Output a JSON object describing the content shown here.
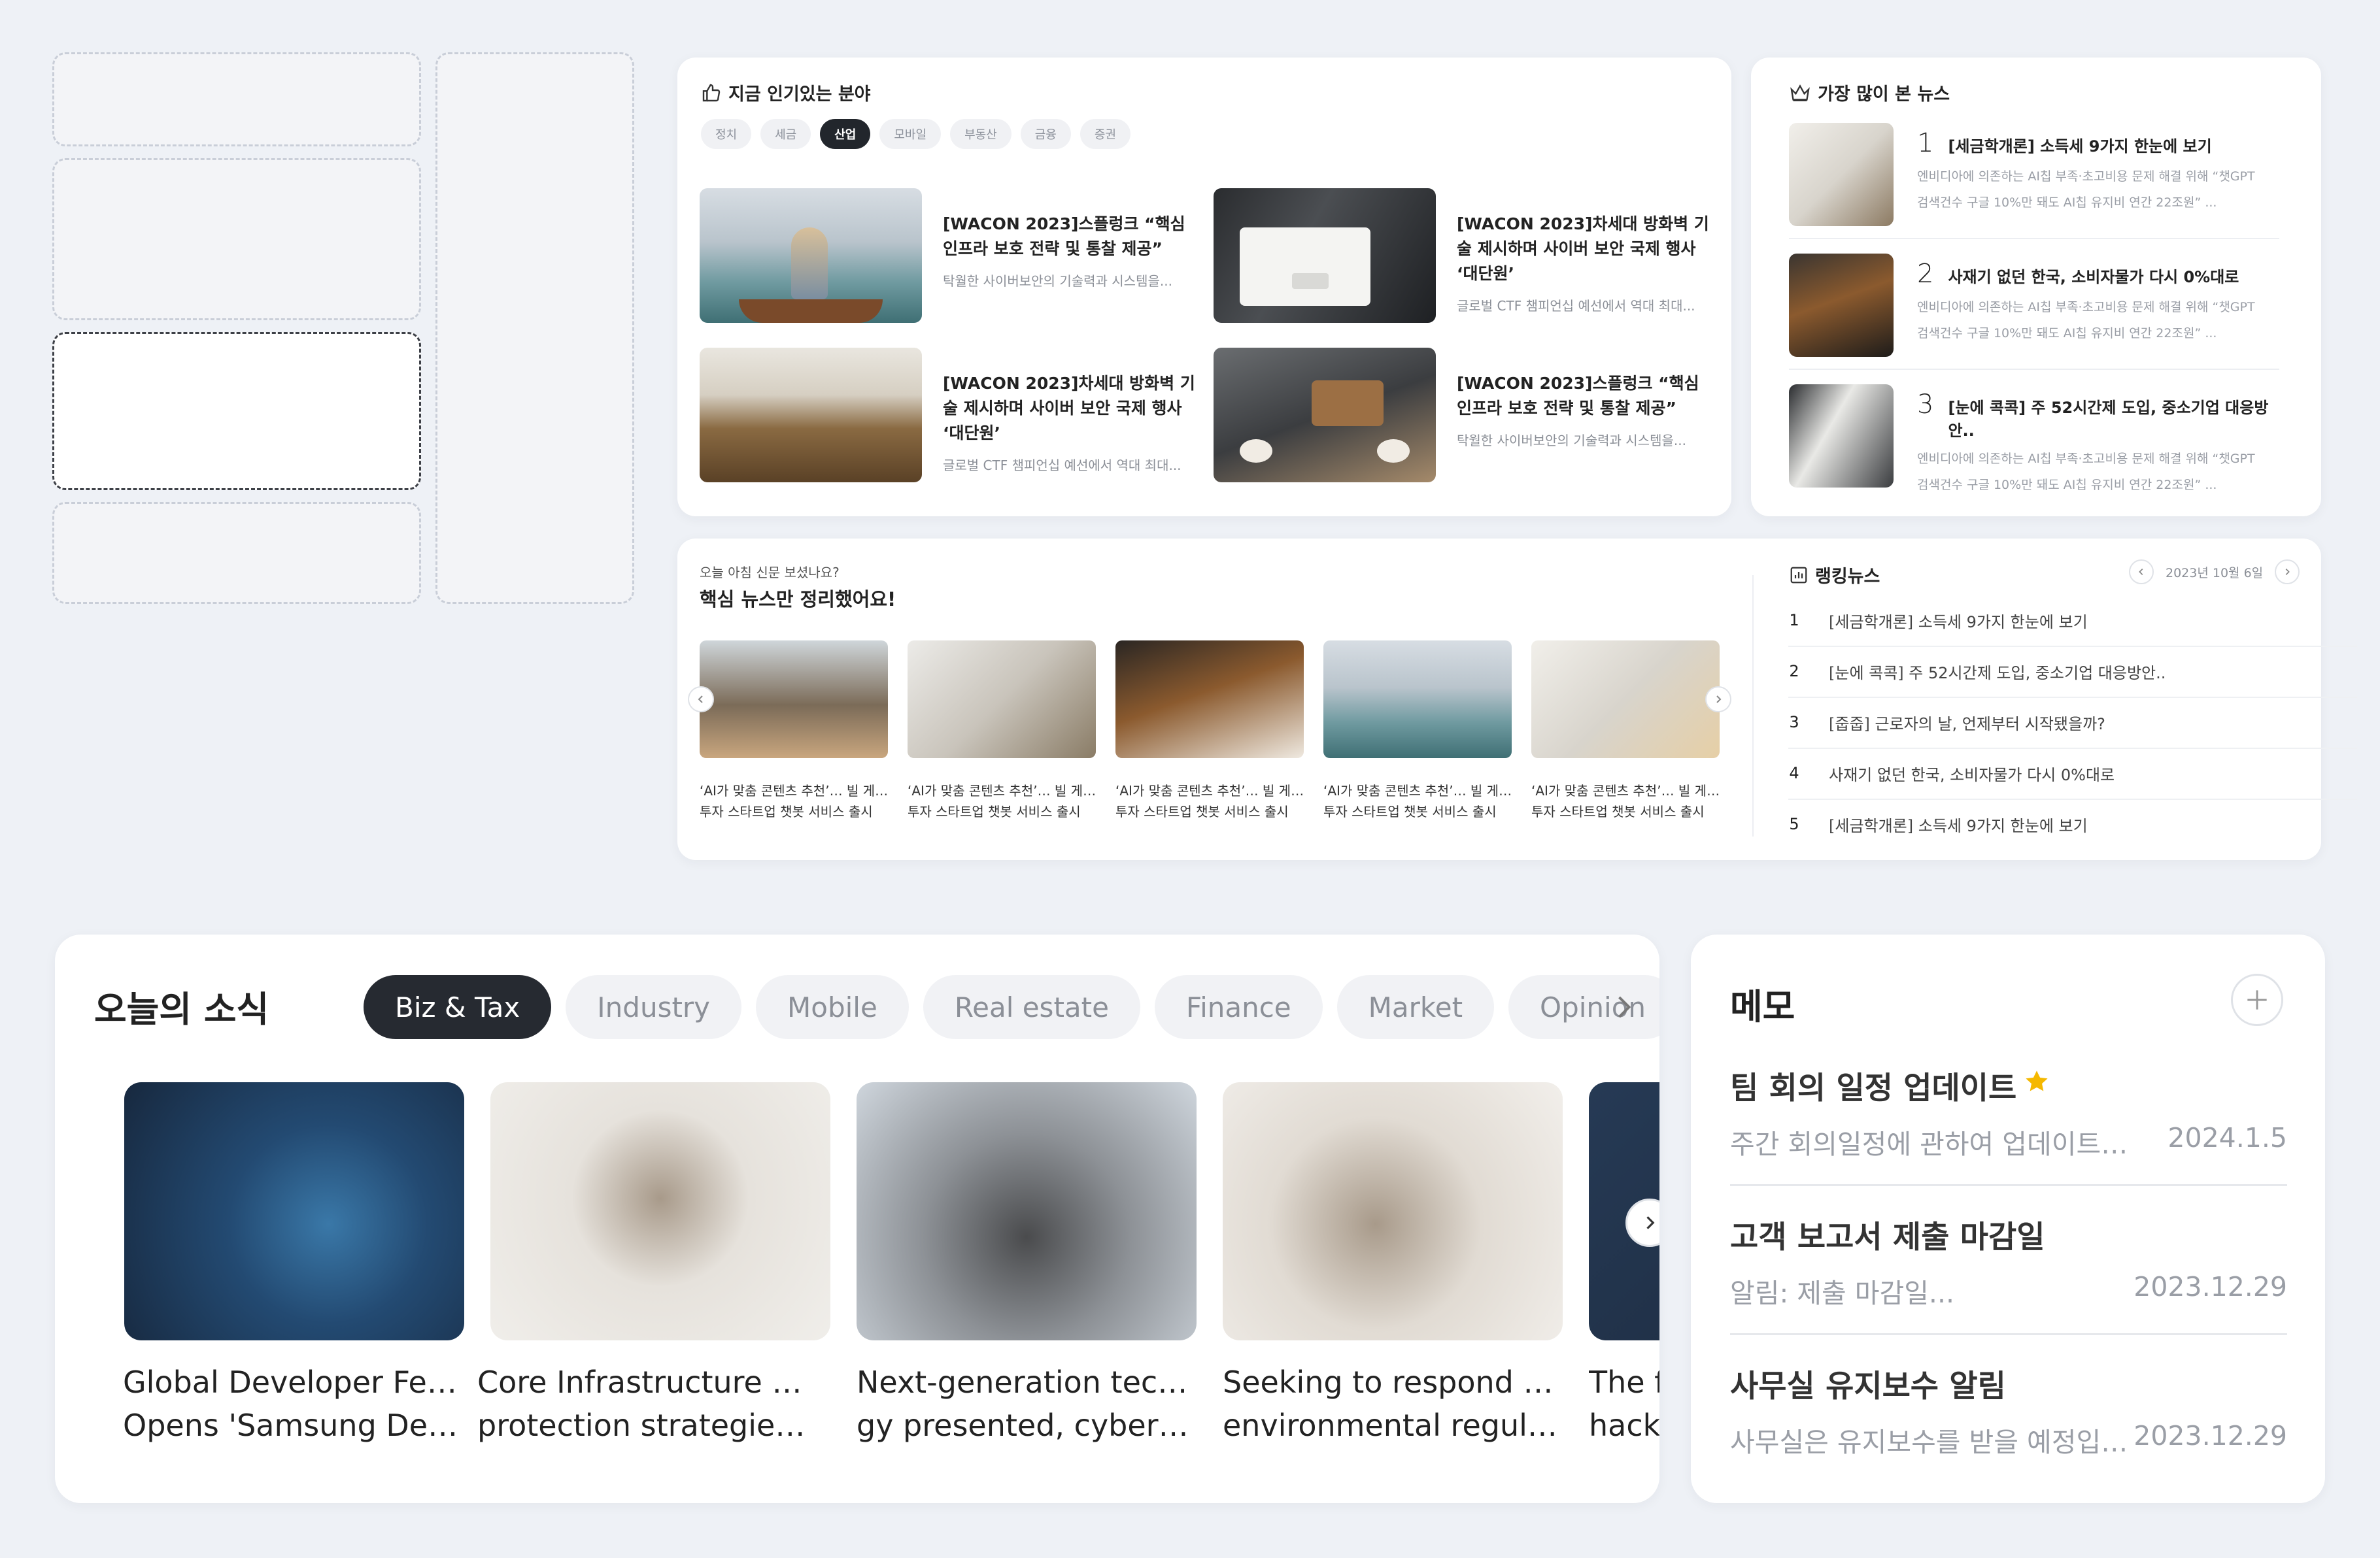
{
  "popular_fields": {
    "title": "지금 인기있는 분야",
    "chips": [
      "정치",
      "세금",
      "산업",
      "모바일",
      "부동산",
      "금융",
      "증권"
    ],
    "active_chip": "산업",
    "items": [
      {
        "title": "[WACON 2023]스플렁크 “핵심 인프라 보호 전략 및 통찰 제공”",
        "desc": "탁월한 사이버보안의 기술력과 시스템을..."
      },
      {
        "title": "[WACON 2023]차세대 방화벽 기술 제시하며 사이버 보안 국제 행사 ‘대단원’",
        "desc": "글로벌 CTF 챔피언십 예선에서 역대 최대..."
      },
      {
        "title": "[WACON 2023]차세대 방화벽 기술 제시하며 사이버 보안 국제 행사 ‘대단원’",
        "desc": "글로벌 CTF 챔피언십 예선에서 역대 최대..."
      },
      {
        "title": "[WACON 2023]스플렁크 “핵심 인프라 보호 전략 및 통찰 제공”",
        "desc": "탁월한 사이버보안의 기술력과 시스템을..."
      }
    ]
  },
  "most_read": {
    "title": "가장 많이 본 뉴스",
    "items": [
      {
        "rank": "1",
        "title": "[세금학개론] 소득세 9가지 한눈에 보기",
        "desc1": "엔비디아에 의존하는 AI칩 부족·초고비용 문제 해결 위해 “챗GPT",
        "desc2": "검색건수 구글 10%만 돼도 AI칩 유지비 연간 22조원” ..."
      },
      {
        "rank": "2",
        "title": "사재기 없던 한국, 소비자물가 다시 0%대로",
        "desc1": "엔비디아에 의존하는 AI칩 부족·초고비용 문제 해결 위해 “챗GPT",
        "desc2": "검색건수 구글 10%만 돼도 AI칩 유지비 연간 22조원” ..."
      },
      {
        "rank": "3",
        "title": "[눈에 콕콕] 주 52시간제 도입, 중소기업 대응방안..",
        "desc1": "엔비디아에 의존하는 AI칩 부족·초고비용 문제 해결 위해 “챗GPT",
        "desc2": "검색건수 구글 10%만 돼도 AI칩 유지비 연간 22조원” ..."
      }
    ]
  },
  "morning": {
    "eyebrow": "오늘 아침 신문 보셨나요?",
    "title": "핵심 뉴스만 정리했어요!",
    "items": [
      {
        "line1": "‘AI가 맞춤 콘텐츠 추천’… 빌 게이츠",
        "line2": "투자 스타트업 챗봇 서비스 출시"
      },
      {
        "line1": "‘AI가 맞춤 콘텐츠 추천’… 빌 게이츠",
        "line2": "투자 스타트업 챗봇 서비스 출시"
      },
      {
        "line1": "‘AI가 맞춤 콘텐츠 추천’… 빌 게이츠",
        "line2": "투자 스타트업 챗봇 서비스 출시"
      },
      {
        "line1": "‘AI가 맞춤 콘텐츠 추천’… 빌 게이츠",
        "line2": "투자 스타트업 챗봇 서비스 출시"
      },
      {
        "line1": "‘AI가 맞춤 콘텐츠 추천’… 빌 게이츠",
        "line2": "투자 스타트업 챗봇 서비스 출시"
      }
    ]
  },
  "ranking": {
    "title": "랭킹뉴스",
    "date": "2023년 10월 6일",
    "items": [
      {
        "rank": "1",
        "title": "[세금학개론] 소득세 9가지 한눈에 보기"
      },
      {
        "rank": "2",
        "title": "[눈에 콕콕] 주 52시간제 도입, 중소기업 대응방안.."
      },
      {
        "rank": "3",
        "title": "[줍줍] 근로자의 날, 언제부터 시작됐을까?"
      },
      {
        "rank": "4",
        "title": "사재기 없던 한국, 소비자물가 다시 0%대로"
      },
      {
        "rank": "5",
        "title": "[세금학개론] 소득세 9가지 한눈에 보기"
      }
    ]
  },
  "today": {
    "title": "오늘의 소식",
    "chips": [
      "Biz & Tax",
      "Industry",
      "Mobile",
      "Real estate",
      "Finance",
      "Market",
      "Opinion"
    ],
    "active_chip": "Biz & Tax",
    "items": [
      {
        "line1": "Global Developer Festival",
        "line2": "Opens 'Samsung Devel..."
      },
      {
        "line1": "Core Infrastructure provide",
        "line2": "protection strategies and..."
      },
      {
        "line1": "Next-generation technolo",
        "line2": "gy presented, cybersecur..."
      },
      {
        "line1": "Seeking to respond to EU",
        "line2": "environmental regulation"
      },
      {
        "line1": "The f",
        "line2": "hacki"
      }
    ]
  },
  "memo": {
    "title": "메모",
    "items": [
      {
        "title": "팀 회의 일정 업데이트",
        "starred": true,
        "preview": "주간 회의일정에 관하여 업데이트가 있...",
        "date": "2024.1.5"
      },
      {
        "title": "고객 보고서 제출 마감일",
        "starred": false,
        "preview": "알림: 제출 마감일...",
        "date": "2023.12.29"
      },
      {
        "title": "사무실 유지보수 알림",
        "starred": false,
        "preview": "사무실은 유지보수를 받을 예정입니...",
        "date": "2023.12.29"
      }
    ]
  },
  "colors": {
    "background": "#eef1f6",
    "accent_dark": "#22262c",
    "star": "#f5b800",
    "muted": "#8b8f97"
  }
}
